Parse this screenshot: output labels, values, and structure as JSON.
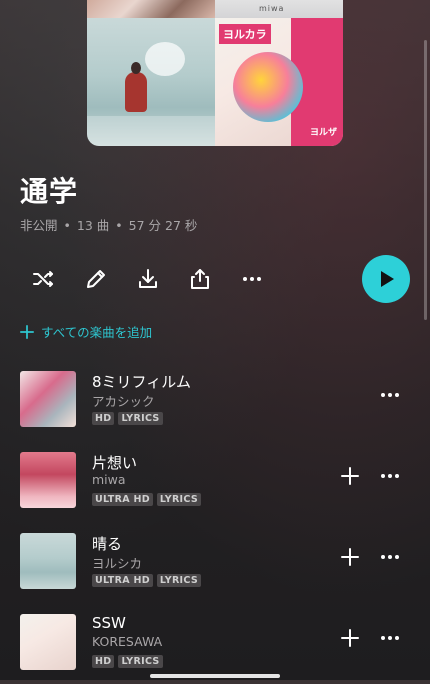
{
  "cover": {
    "artist_text": "miwa",
    "tile_title": "ヨルカラ",
    "tile_subtitle": "ヨルザ"
  },
  "playlist": {
    "title": "通学",
    "visibility": "非公開",
    "track_count": "13 曲",
    "duration": "57 分 27 秒"
  },
  "actions": {
    "icons": [
      "shuffle-icon",
      "pencil-icon",
      "download-icon",
      "share-icon",
      "more-icon"
    ],
    "play_icon": "play-icon",
    "add_all_label": "すべての楽曲を追加"
  },
  "tracks": [
    {
      "title": "8ミリフィルム",
      "artist": "アカシック",
      "tags": [
        "HD",
        "LYRICS"
      ],
      "show_add": false
    },
    {
      "title": "片想い",
      "artist": "miwa",
      "tags": [
        "ULTRA HD",
        "LYRICS"
      ],
      "show_add": true
    },
    {
      "title": "晴る",
      "artist": "ヨルシカ",
      "tags": [
        "ULTRA HD",
        "LYRICS"
      ],
      "show_add": true
    },
    {
      "title": "SSW",
      "artist": "KORESAWA",
      "tags": [
        "HD",
        "LYRICS"
      ],
      "show_add": true
    }
  ],
  "colors": {
    "accent": "#2dd0d8",
    "background": "#232123",
    "secondary_text": "#a9a6a8"
  }
}
